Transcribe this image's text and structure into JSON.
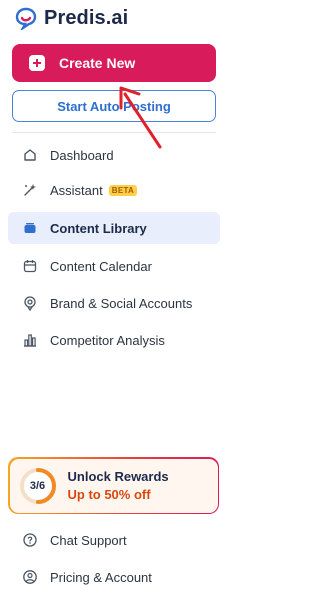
{
  "brand": {
    "name": "Predis.ai"
  },
  "actions": {
    "create_new": "Create New",
    "start_auto_posting": "Start Auto Posting"
  },
  "nav": {
    "items": [
      {
        "label": "Dashboard",
        "icon": "dashboard-icon"
      },
      {
        "label": "Assistant",
        "icon": "assistant-icon",
        "badge": "BETA"
      },
      {
        "label": "Content Library",
        "icon": "library-icon",
        "active": true
      },
      {
        "label": "Content Calendar",
        "icon": "calendar-icon"
      },
      {
        "label": "Brand & Social Accounts",
        "icon": "brand-icon"
      },
      {
        "label": "Competitor Analysis",
        "icon": "chart-icon"
      }
    ]
  },
  "rewards": {
    "progress_text": "3/6",
    "progress_fraction": 0.5,
    "title": "Unlock Rewards",
    "subtitle": "Up to 50% off"
  },
  "footer": {
    "items": [
      {
        "label": "Chat Support",
        "icon": "help-circle-icon"
      },
      {
        "label": "Pricing & Account",
        "icon": "user-circle-icon"
      }
    ]
  },
  "colors": {
    "primary": "#d81b5a",
    "accent_blue": "#2f6fd0",
    "active_bg": "#e8eefb",
    "annotation_arrow": "#e0202a"
  }
}
